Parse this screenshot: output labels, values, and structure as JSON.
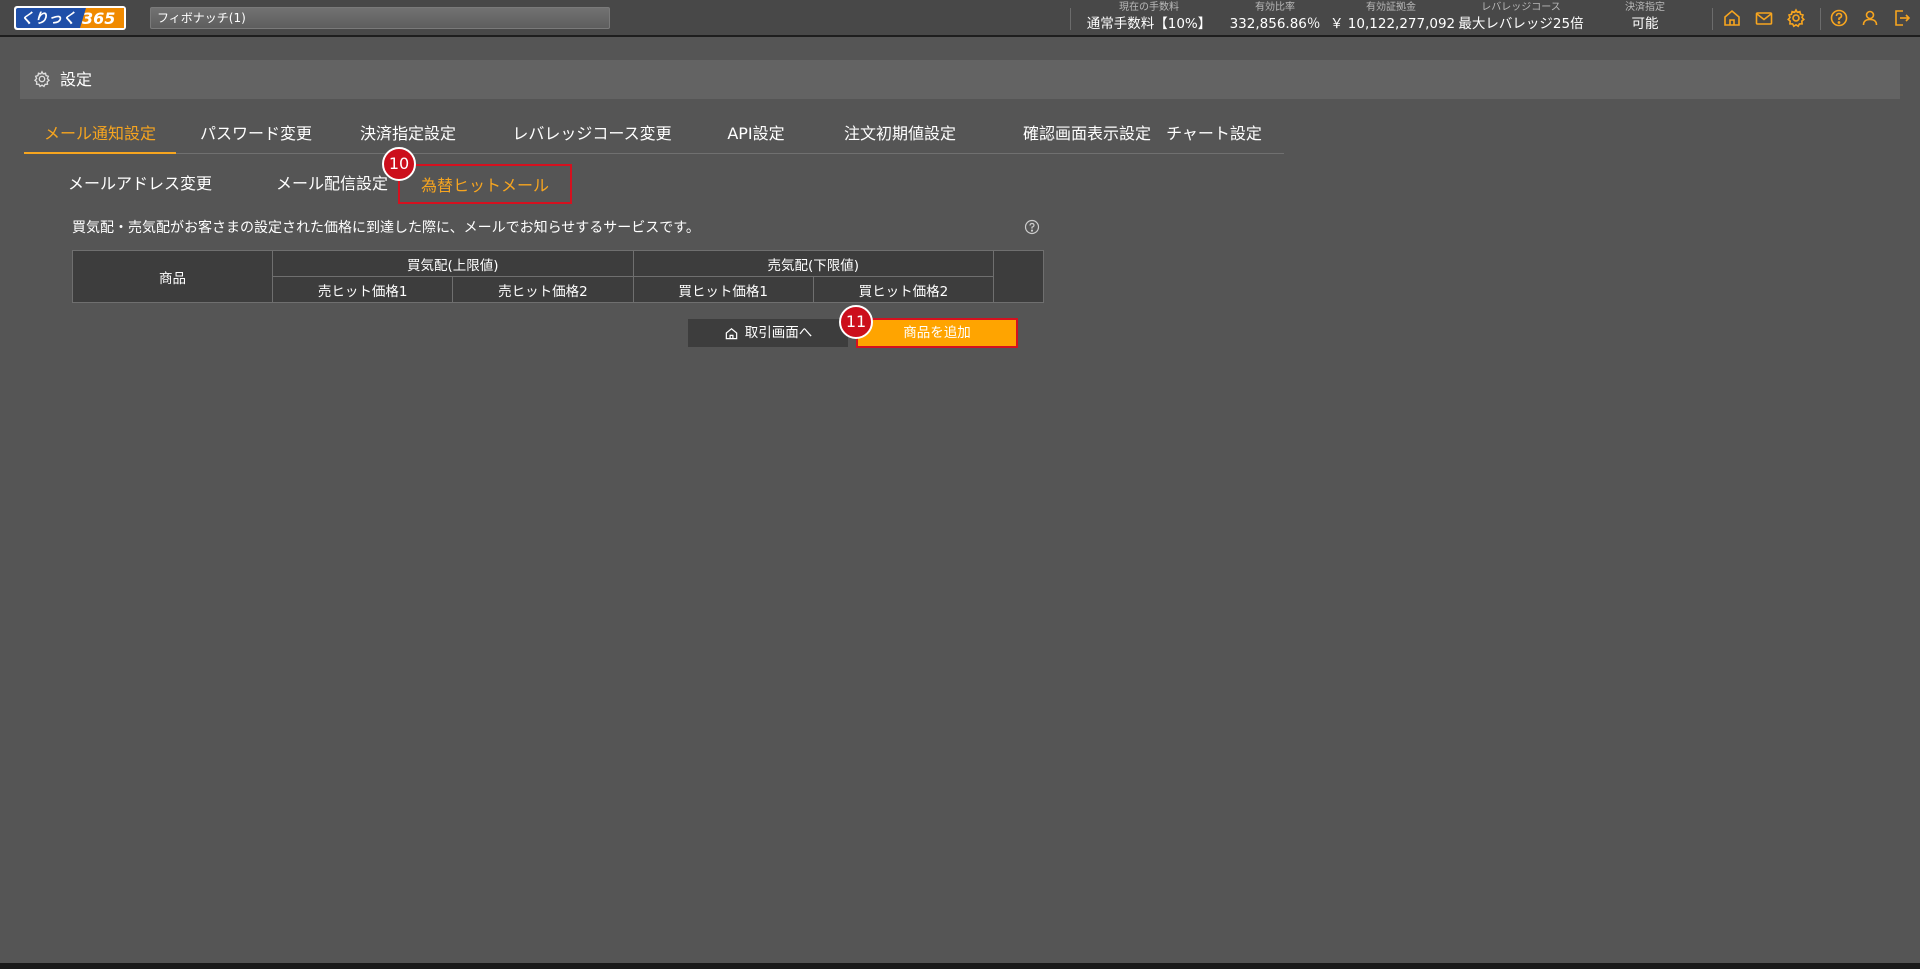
{
  "topbar": {
    "logo_text": "くりっく365",
    "account": "フィボナッチ(1)",
    "stats": [
      {
        "label": "現在の手数料",
        "value": "通常手数料【10%】"
      },
      {
        "label": "有効比率",
        "value": "332,856.86％"
      },
      {
        "label": "有効証拠金",
        "value": "￥ 10,122,277,092"
      },
      {
        "label": "レバレッジコース",
        "value": "最大レバレッジ25倍"
      },
      {
        "label": "決済指定",
        "value": "可能"
      }
    ]
  },
  "page": {
    "title": "設定"
  },
  "tabs": [
    "メール通知設定",
    "パスワード変更",
    "決済指定設定",
    "レバレッジコース変更",
    "API設定",
    "注文初期値設定",
    "確認画面表示設定",
    "チャート設定"
  ],
  "subtabs": [
    "メールアドレス変更",
    "メール配信設定",
    "為替ヒットメール"
  ],
  "badges": {
    "subtab": "10",
    "add": "11"
  },
  "description": "買気配・売気配がお客さまの設定された価格に到達した際に、メールでお知らせするサービスです。",
  "table": {
    "product": "商品",
    "buy_group": "買気配(上限値)",
    "sell_group": "売気配(下限値)",
    "cols": [
      "売ヒット価格1",
      "売ヒット価格2",
      "買ヒット価格1",
      "買ヒット価格2"
    ]
  },
  "buttons": {
    "trade": "取引画面へ",
    "add": "商品を追加"
  },
  "colors": {
    "accent": "#f7a51f",
    "highlight": "#d4111f",
    "add_button": "#ffa400",
    "background": "#555555"
  }
}
